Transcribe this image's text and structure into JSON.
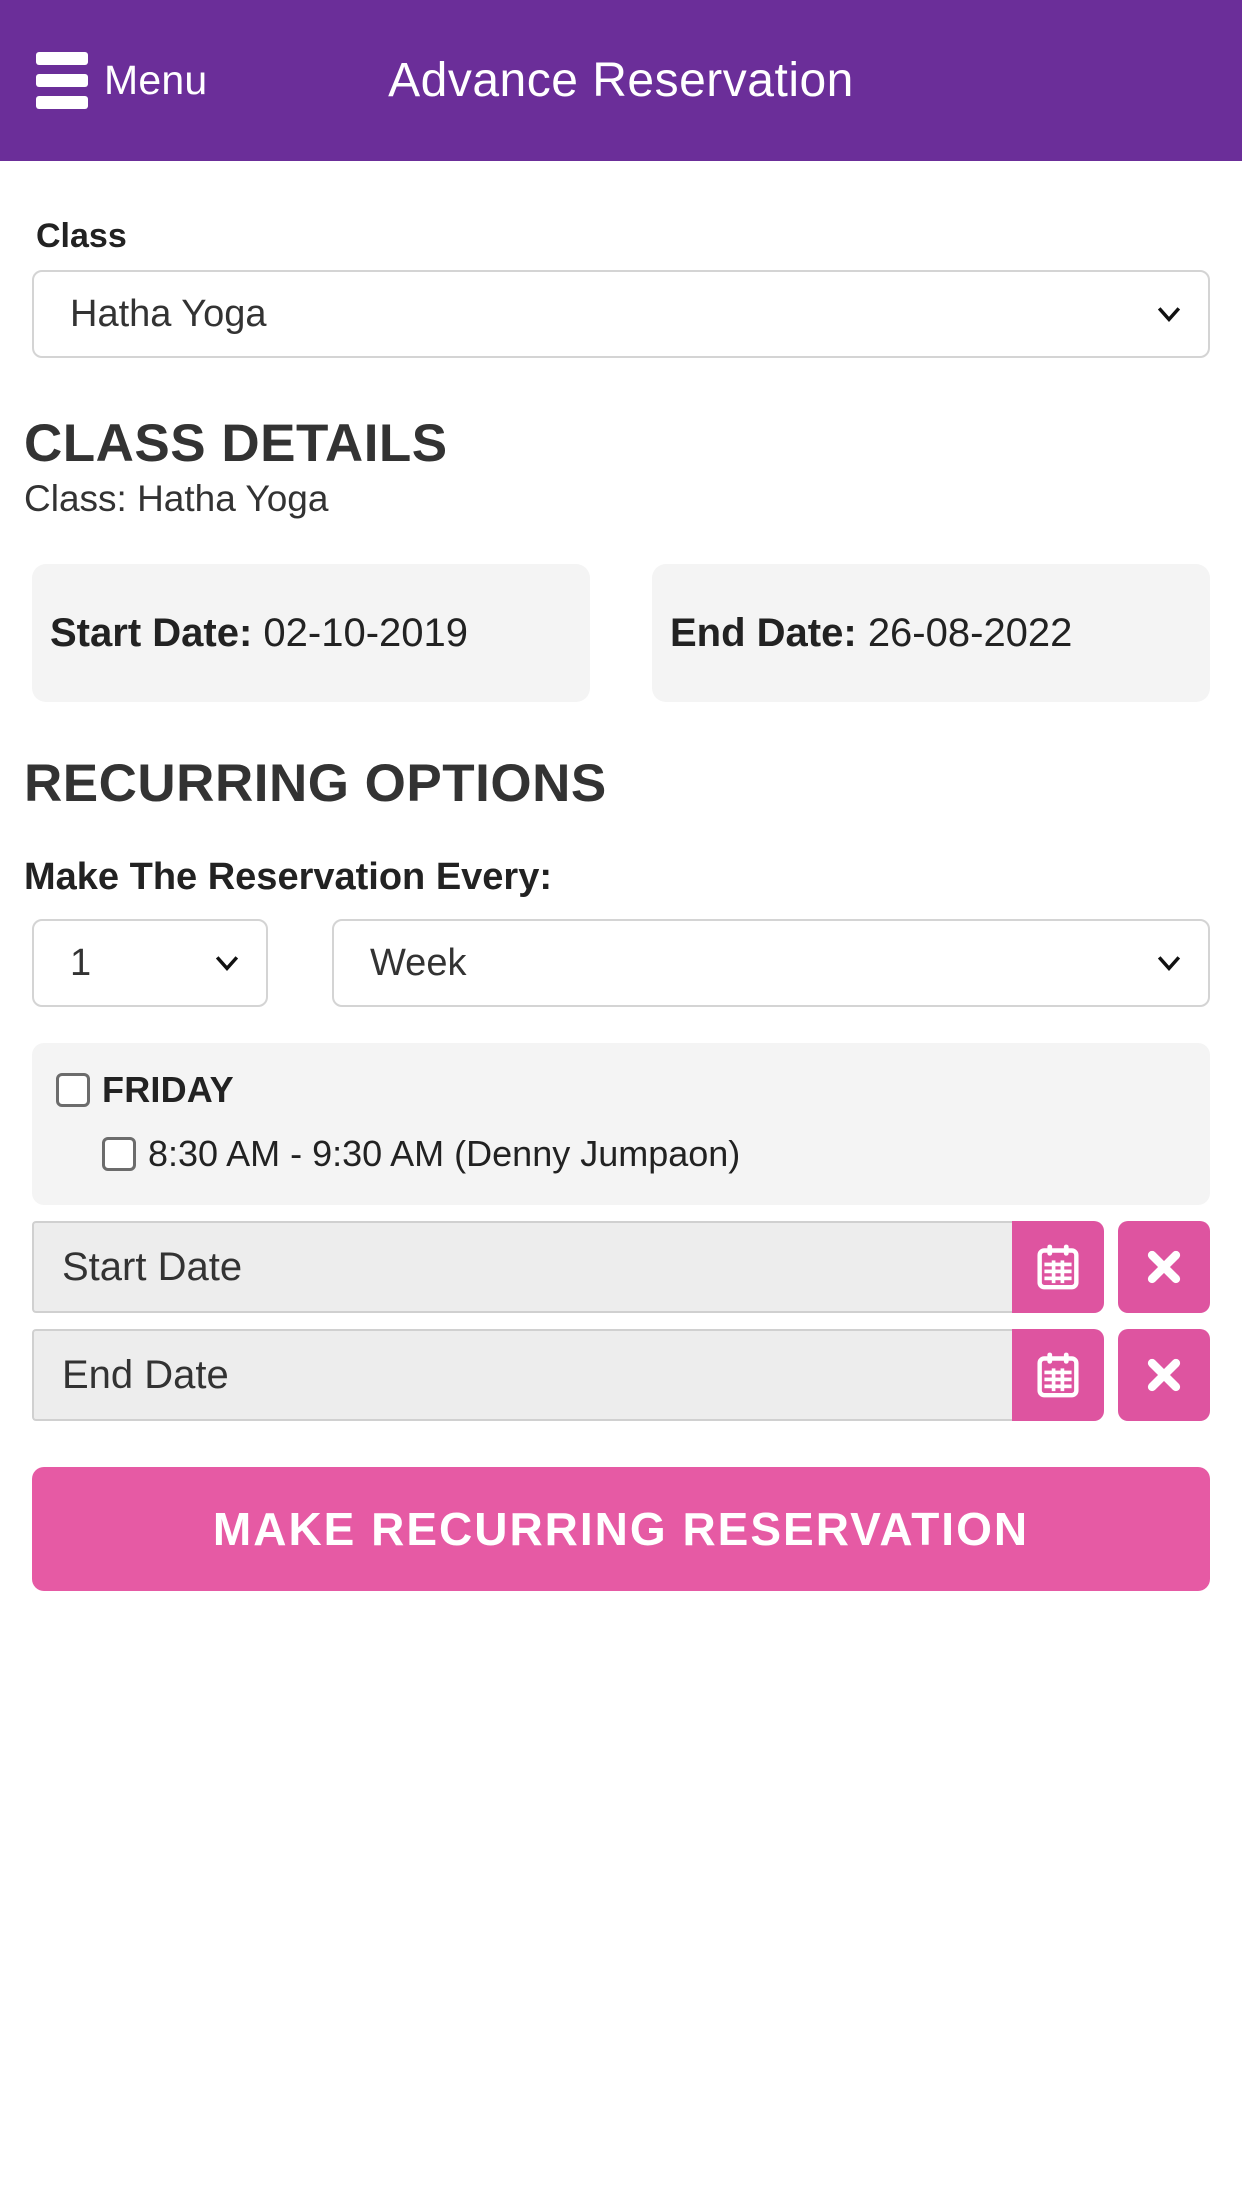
{
  "header": {
    "menu_label": "Menu",
    "title": "Advance Reservation",
    "bg_color": "#6b2e99"
  },
  "class_field": {
    "label": "Class",
    "selected": "Hatha Yoga"
  },
  "class_details": {
    "heading": "CLASS DETAILS",
    "class_line": "Class: Hatha Yoga",
    "start": {
      "label": "Start Date:",
      "value": "02-10-2019"
    },
    "end": {
      "label": "End Date:",
      "value": "26-08-2022"
    }
  },
  "recurring": {
    "heading": "RECURRING OPTIONS",
    "every_label": "Make The Reservation Every:",
    "interval_selected": "1",
    "unit_selected": "Week",
    "day": {
      "name": "FRIDAY",
      "slot": "8:30 AM - 9:30 AM (Denny Jumpaon)"
    },
    "start_date_placeholder": "Start Date",
    "end_date_placeholder": "End Date",
    "start_date_value": "",
    "end_date_value": "",
    "submit_label": "MAKE RECURRING RESERVATION",
    "accent_color": "#e65aa4"
  }
}
